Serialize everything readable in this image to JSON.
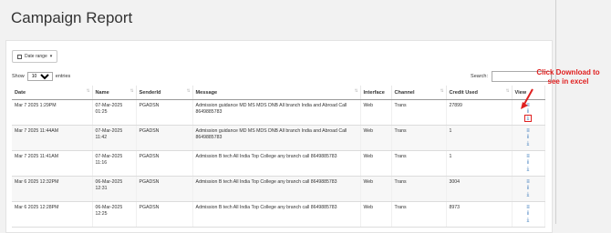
{
  "page": {
    "title": "Campaign Report"
  },
  "filters": {
    "date_range_label": "Date range",
    "show_label": "Show",
    "entries_value": "10",
    "entries_label": "entries",
    "search_label": "Search:",
    "search_value": ""
  },
  "table": {
    "columns": [
      "Date",
      "Name",
      "SenderId",
      "Message",
      "Interface",
      "Channel",
      "Credit Used",
      "View"
    ],
    "rows": [
      {
        "date": "Mar 7 2025 1:29PM",
        "name": "07-Mar-2025 01:25",
        "sender": "PGADSN",
        "message": "Admission guidance MD MS MDS DNB All branch India and Abroad Call 8649885783",
        "interface": "Web",
        "channel": "Trans",
        "credit": "27899"
      },
      {
        "date": "Mar 7 2025 11:44AM",
        "name": "07-Mar-2025 11:42",
        "sender": "PGADSN",
        "message": "Admission guidance MD MS MDS DNB All branch India and Abroad Call 8649885783",
        "interface": "Web",
        "channel": "Trans",
        "credit": "1"
      },
      {
        "date": "Mar 7 2025 11:41AM",
        "name": "07-Mar-2025 11:16",
        "sender": "PGADSN",
        "message": "Admission B tech All India Top College any branch call 8649885783",
        "interface": "Web",
        "channel": "Trans",
        "credit": "1"
      },
      {
        "date": "Mar 6 2025 12:32PM",
        "name": "06-Mar-2025 12:31",
        "sender": "PGADSN",
        "message": "Admission B tech All India Top College any branch call 8649885783",
        "interface": "Web",
        "channel": "Trans",
        "credit": "3004"
      },
      {
        "date": "Mar 6 2025 12:28PM",
        "name": "06-Mar-2025 12:25",
        "sender": "PGADSN",
        "message": "Admission B tech All India Top College any branch call 8649885783",
        "interface": "Web",
        "channel": "Trans",
        "credit": "8973"
      }
    ]
  },
  "annotation": {
    "text": "Click Download to see in excel",
    "color": "#e02020"
  },
  "icons": {
    "list": "list-icon",
    "info": "info-icon",
    "download": "download-icon",
    "calendar": "calendar-icon"
  }
}
